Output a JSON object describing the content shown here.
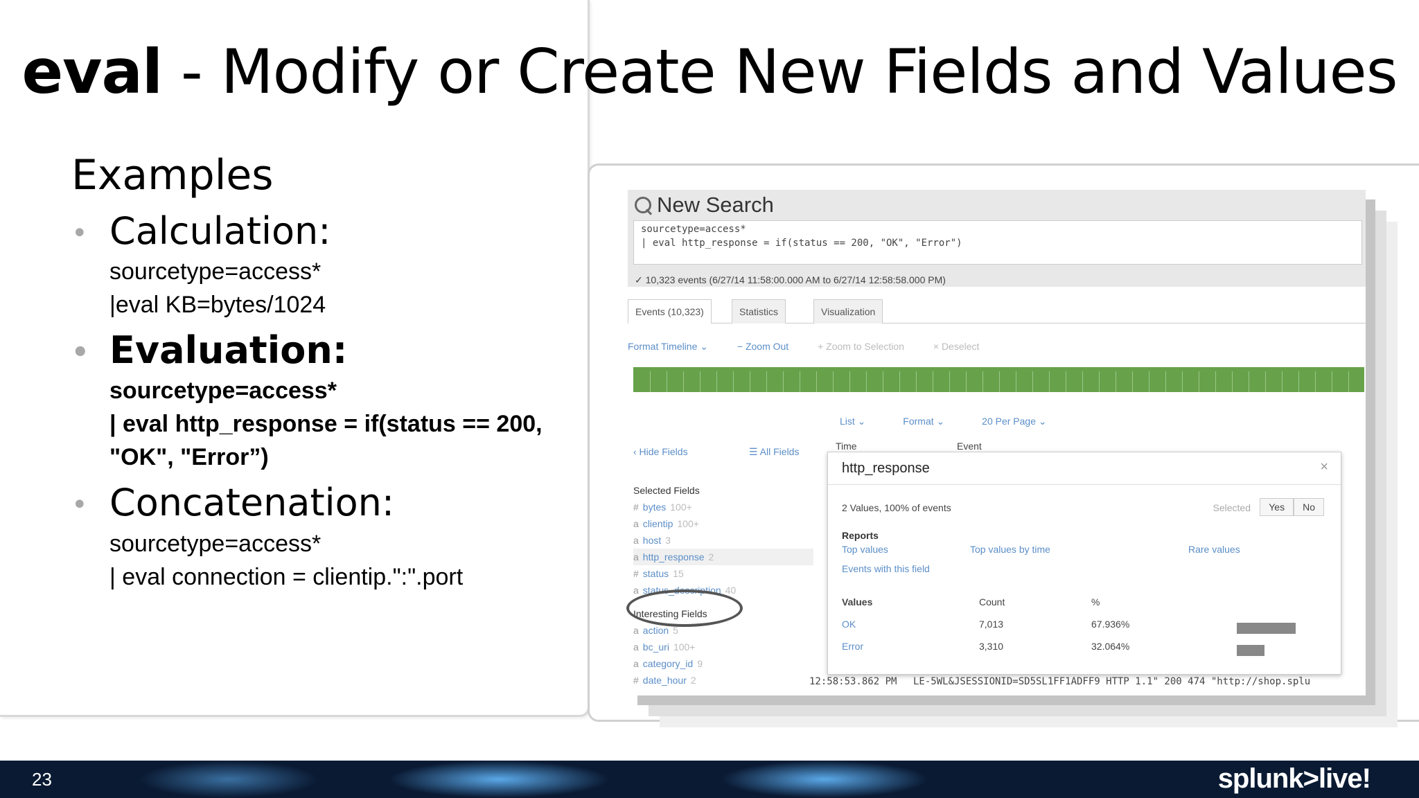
{
  "slide": {
    "title_bold": "eval",
    "title_rest": " - Modify or Create New Fields and Values",
    "examples": "Examples",
    "bullets": [
      {
        "label": "Calculation:",
        "lines": [
          "sourcetype=access*",
          "|eval KB=bytes/1024"
        ]
      },
      {
        "label": "Evaluation:",
        "lines": [
          "sourcetype=access*",
          "| eval http_response = if(status == 200,",
          "\"OK\", \"Error”)"
        ]
      },
      {
        "label": "Concatenation:",
        "lines": [
          "sourcetype=access*",
          "| eval connection = clientip.\":\".port"
        ]
      }
    ],
    "page_number": "23",
    "logo": "splunk>live!"
  },
  "screenshot": {
    "header": "New Search",
    "query_line1": "sourcetype=access*",
    "query_line2": "| eval http_response = if(status == 200, \"OK\", \"Error\")",
    "events_summary": "✓ 10,323 events (6/27/14 11:58:00.000 AM to 6/27/14 12:58:58.000 PM)",
    "tabs": [
      "Events (10,323)",
      "Statistics",
      "Visualization"
    ],
    "timeline_controls": [
      "Format Timeline ⌄",
      "− Zoom Out",
      "+ Zoom to Selection",
      "× Deselect"
    ],
    "list_controls": [
      "List ⌄",
      "Format ⌄",
      "20 Per Page ⌄"
    ],
    "hide_fields": "‹ Hide Fields",
    "all_fields": "☰ All Fields",
    "selected_fields_label": "Selected Fields",
    "selected_fields": [
      {
        "type": "#",
        "name": "bytes",
        "count": "100+"
      },
      {
        "type": "a",
        "name": "clientip",
        "count": "100+"
      },
      {
        "type": "a",
        "name": "host",
        "count": "3"
      },
      {
        "type": "a",
        "name": "http_response",
        "count": "2"
      },
      {
        "type": "#",
        "name": "status",
        "count": "15"
      },
      {
        "type": "a",
        "name": "status_description",
        "count": "40"
      }
    ],
    "interesting_fields_label": "Interesting Fields",
    "interesting_fields": [
      {
        "type": "a",
        "name": "action",
        "count": "5"
      },
      {
        "type": "a",
        "name": "bc_uri",
        "count": "100+"
      },
      {
        "type": "a",
        "name": "category_id",
        "count": "9"
      },
      {
        "type": "#",
        "name": "date_hour",
        "count": "2"
      }
    ],
    "col_time": "Time",
    "col_event": "Event",
    "popup": {
      "title": "http_response",
      "close": "×",
      "summary": "2 Values, 100% of events",
      "selected_label": "Selected",
      "yes": "Yes",
      "no": "No",
      "reports_label": "Reports",
      "report_links": [
        "Top values",
        "Top values by time",
        "Rare values"
      ],
      "events_with_field": "Events with this field",
      "col_values": "Values",
      "col_count": "Count",
      "col_pct": "%",
      "rows": [
        {
          "value": "OK",
          "count": "7,013",
          "pct": "67.936%",
          "frac": 0.679
        },
        {
          "value": "Error",
          "count": "3,310",
          "pct": "32.064%",
          "frac": 0.321
        }
      ]
    },
    "bottom_time": "12:58:53.862 PM",
    "bottom_event": "LE-5WL&JSESSIONID=SD5SL1FF1ADFF9 HTTP 1.1\" 200 474 \"http://shop.splu"
  }
}
